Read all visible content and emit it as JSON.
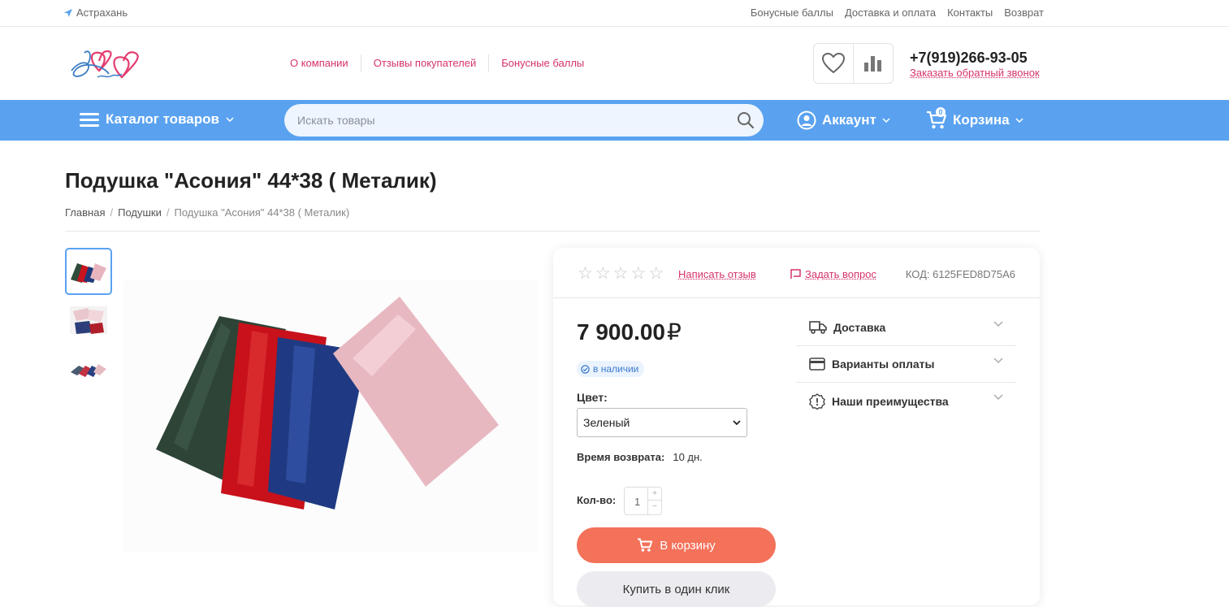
{
  "topbar": {
    "city": "Астрахань",
    "links": [
      "Бонусные баллы",
      "Доставка и оплата",
      "Контакты",
      "Возврат"
    ]
  },
  "header": {
    "nav": [
      "О компании",
      "Отзывы покупателей",
      "Бонусные баллы"
    ],
    "phone": "+7(919)266-93-05",
    "callback": "Заказать обратный звонок",
    "icons": [
      "heart-icon",
      "compare-chart-icon"
    ]
  },
  "bluebar": {
    "catalog": "Каталог товаров",
    "search_placeholder": "Искать товары",
    "account": "Аккаунт",
    "cart": "Корзина",
    "cart_count": "0"
  },
  "product": {
    "title": "Подушка \"Асония\" 44*38 ( Металик)",
    "breadcrumb": [
      "Главная",
      "Подушки",
      "Подушка \"Асония\" 44*38 ( Металик)"
    ],
    "rating_stars": 0,
    "write_review": "Написать отзыв",
    "ask_question": "Задать вопрос",
    "code": "КОД: 6125FED8D75A6",
    "price": "7 900.00",
    "currency": "₽",
    "stock": "в наличии",
    "color_label": "Цвет:",
    "color_value": "Зеленый",
    "return_label": "Время возврата:",
    "return_value": "10 дн.",
    "qty_label": "Кол-во:",
    "qty_value": "1",
    "add_to_cart": "В корзину",
    "one_click": "Купить в один клик",
    "accordion": [
      "Доставка",
      "Варианты оплаты",
      "Наши преимущества"
    ]
  },
  "colors": {
    "accent_blue": "#5aa2f0",
    "link_pink": "#d6336c",
    "cart_button": "#f4715a"
  }
}
